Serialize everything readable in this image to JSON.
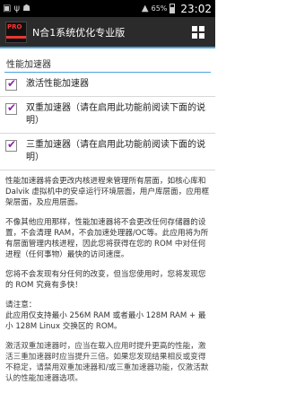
{
  "status_bar": {
    "battery": "65%",
    "time": "23:02",
    "left_icons": [
      "app-notification-icon",
      "usb-icon",
      "android-debug-icon"
    ],
    "right_icons": [
      "signal-icon",
      "battery-icon"
    ]
  },
  "action_bar": {
    "app_icon_text": "PRO",
    "title": "N合1系统优化专业版"
  },
  "section": {
    "header": "性能加速器"
  },
  "options": [
    {
      "label": "激活性能加速器",
      "checked": true
    },
    {
      "label": "双重加速器（请在启用此功能前阅读下面的说明）",
      "checked": true
    },
    {
      "label": "三重加速器（请在启用此功能前阅读下面的说明）",
      "checked": true
    }
  ],
  "description": {
    "p1": "性能加速器将会更改内核进程来管理所有层面，如核心库和 Dalvik 虚拟机中的安卓运行环境层面，用户库层面，应用框架层面，及应用层面。",
    "p2": "不像其他应用那样，性能加速器将不会更改任何存储器的设置，不会清理 RAM，不会加速处理器/OC等。此应用将为所有层面管理内核进程，因此您将获得在您的 ROM 中对任何进程（任何事物）最快的访问速度。",
    "p3": "您将不会发现有分任何的改变，但当您使用时，您将发现您的 ROM 究竟有多快！",
    "p4": "请注意：\n此应用仅支持最小 256M RAM 或者最小 128M RAM + 最小 128M Linux 交换区的 ROM。",
    "p5": "激活双重加速器时，应当在载入应用时提升更高的性能，激活三重加速器时应当提升三倍。如果您发现结果相反或变得不稳定，请禁用双重加速器和/或三重加速器功能，仅激活默认的性能加速器选项。"
  }
}
